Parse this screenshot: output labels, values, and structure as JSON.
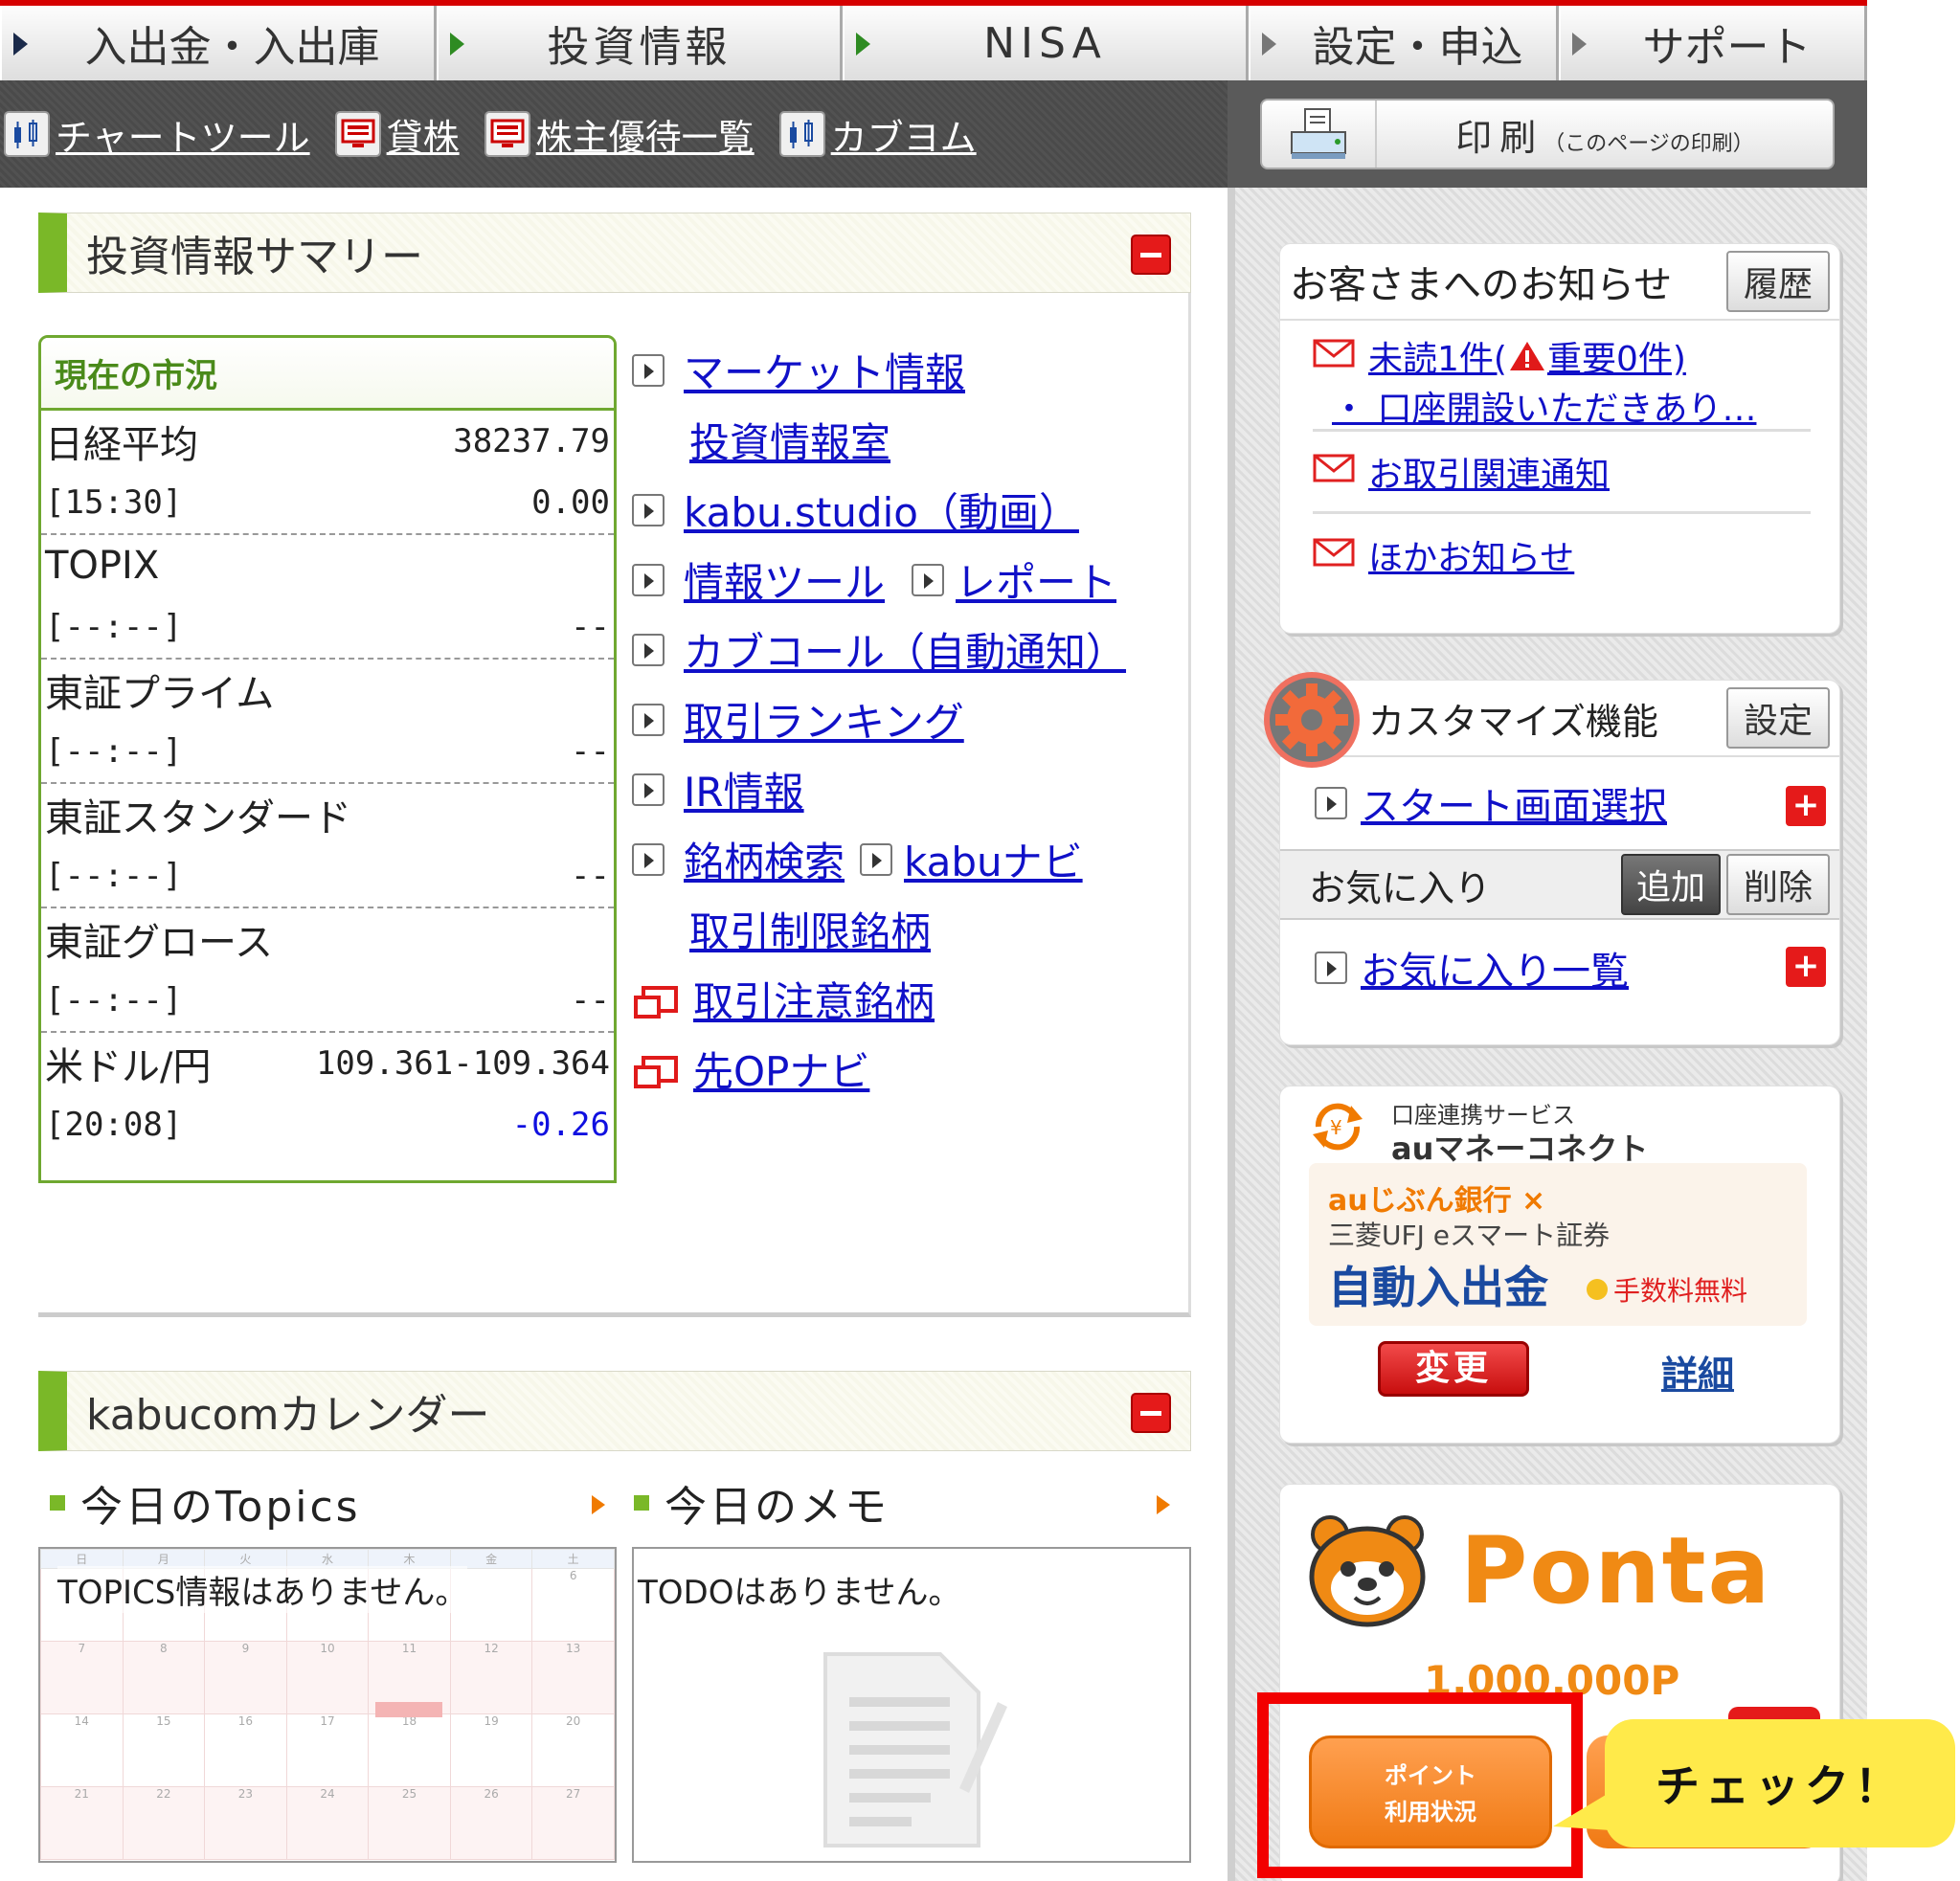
{
  "nav": {
    "tabs": [
      "入出金・入出庫",
      "投資情報",
      "NISA",
      "設定・申込",
      "サポート"
    ]
  },
  "subbar": {
    "items": [
      "チャートツール",
      "貸株",
      "株主優待一覧",
      "カブヨム"
    ],
    "print_main": "印刷",
    "print_sub": "（このページの印刷）"
  },
  "summary": {
    "title": "投資情報サマリー",
    "market_header": "現在の市況",
    "rows": [
      {
        "name": "日経平均",
        "value": "38237.79",
        "time": "[15:30]",
        "change": "0.00"
      },
      {
        "name": "TOPIX",
        "value": "",
        "time": "[--:--]",
        "change": "--"
      },
      {
        "name": "東証プライム",
        "value": "",
        "time": "[--:--]",
        "change": "--"
      },
      {
        "name": "東証スタンダード",
        "value": "",
        "time": "[--:--]",
        "change": "--"
      },
      {
        "name": "東証グロース",
        "value": "",
        "time": "[--:--]",
        "change": "--"
      },
      {
        "name": "米ドル/円",
        "value": "109.361-109.364",
        "time": "[20:08]",
        "change": "-0.26"
      }
    ],
    "links": {
      "market_info": "マーケット情報",
      "research_room": "投資情報室",
      "kabu_studio": "kabu.studio（動画）",
      "info_tools": "情報ツール",
      "report": "レポート",
      "kabucall": "カブコール（自動通知）",
      "ranking": "取引ランキング",
      "ir": "IR情報",
      "search": "銘柄検索",
      "kabunavi": "kabuナビ",
      "restricted": "取引制限銘柄",
      "caution": "取引注意銘柄",
      "op_navi": "先OPナビ"
    }
  },
  "calendar": {
    "title": "kabucomカレンダー",
    "topics_label": "今日のTopics",
    "memo_label": "今日のメモ",
    "topics_empty": "TOPICS情報はありません。",
    "todo_empty": "TODOはありません。",
    "weekdays": [
      "日",
      "月",
      "火",
      "水",
      "木",
      "金",
      "土"
    ],
    "weeks": [
      [
        "",
        "",
        "",
        "",
        "",
        "",
        "6"
      ],
      [
        "7",
        "8",
        "9",
        "10",
        "11",
        "12",
        "13"
      ],
      [
        "14",
        "15",
        "16",
        "17",
        "18",
        "19",
        "20"
      ],
      [
        "21",
        "22",
        "23",
        "24",
        "25",
        "26",
        "27"
      ]
    ]
  },
  "notice": {
    "title": "お客さまへのお知らせ",
    "history_btn": "履歴",
    "unread": "未読1件(",
    "important": "重要0件)",
    "account_notice": "・ 口座開設いただきあり…",
    "trade_notice": "お取引関連通知",
    "other_notice": "ほかお知らせ"
  },
  "customize": {
    "title": "カスタマイズ機能",
    "settings_btn": "設定",
    "start_screen": "スタート画面選択",
    "favorites": "お気に入り",
    "add_btn": "追加",
    "delete_btn": "削除",
    "favorites_list": "お気に入り一覧"
  },
  "au": {
    "service_label": "口座連携サービス",
    "service_name": "auマネーコネクト",
    "bank": "auじぶん銀行 ×",
    "securities": "三菱UFJ eスマート証券",
    "auto": "自動入出金",
    "fee_free": "手数料無料",
    "change_btn": "変更",
    "detail_link": "詳細"
  },
  "ponta": {
    "logo": "Ponta",
    "points": "1,000,000P",
    "btn_line1": "ポイント",
    "btn_line2": "利用状況",
    "callout": "チェック！"
  },
  "colors": {
    "accent_red": "#d60000",
    "link": "#1010c8",
    "green": "#7ab828",
    "ponta_orange": "#f08a14",
    "callout_yellow": "#ffea4a"
  }
}
